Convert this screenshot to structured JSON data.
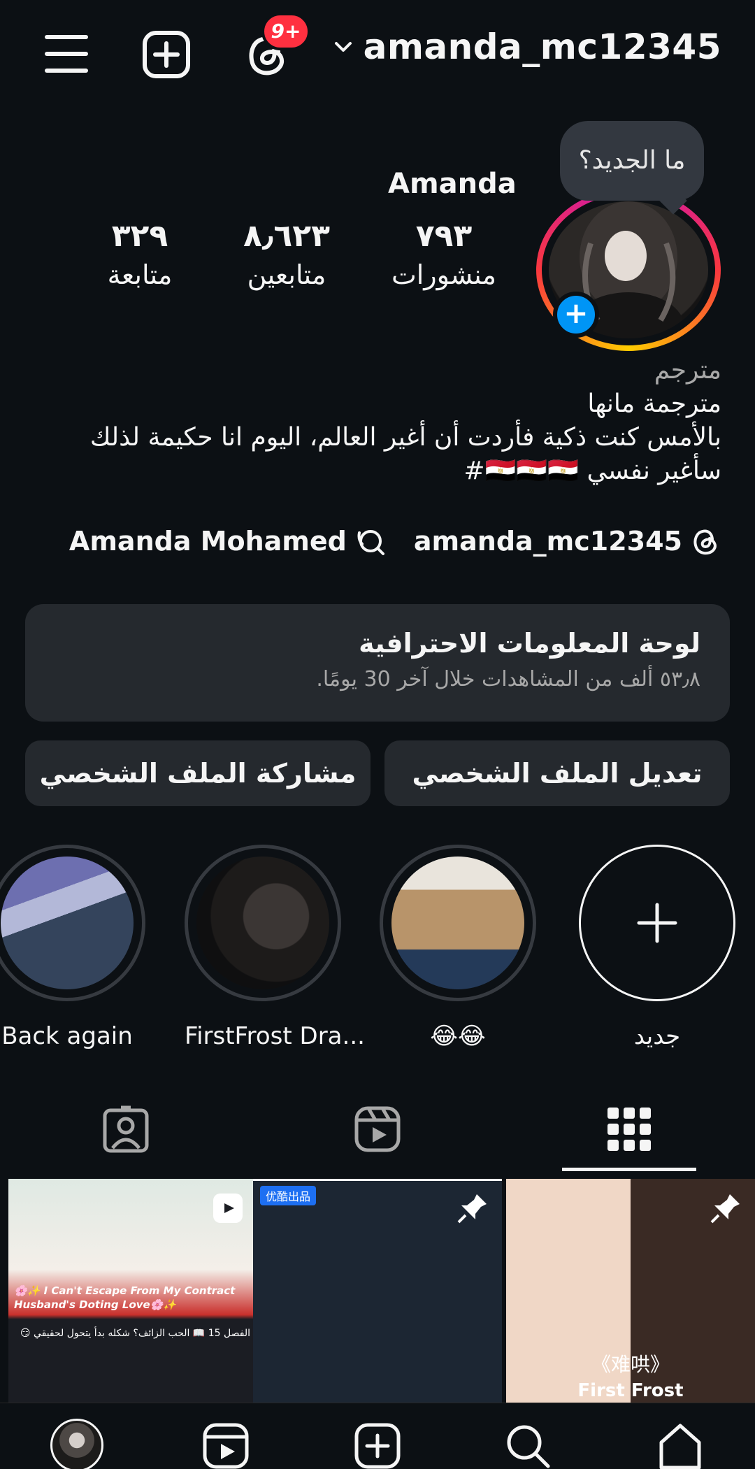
{
  "header": {
    "username": "amanda_mc12345",
    "notification_badge": "9+"
  },
  "tooltip": "ما الجديد؟",
  "profile": {
    "display_name": "Amanda",
    "stats": [
      {
        "num": "٧٩٣",
        "label": "منشورات"
      },
      {
        "num": "٨٫٦٢٣",
        "label": "متابعين"
      },
      {
        "num": "٣٢٩",
        "label": "متابعة"
      }
    ]
  },
  "bio": {
    "category": "مترجم",
    "line1": "مترجمة مانها",
    "line2": "بالأمس كنت ذكية فأردت أن أغير العالم، اليوم انا حكيمة لذلك",
    "line3": "سأغير نفسي 🇪🇬🇪🇬🇪🇬#"
  },
  "links": {
    "threads_handle": "amanda_mc12345",
    "linked_name": "Amanda Mohamed"
  },
  "dashboard": {
    "title": "لوحة المعلومات الاحترافية",
    "subtitle": "٥٣٫٨ ألف من المشاهدات خلال آخر 30 يومًا."
  },
  "buttons": {
    "edit": "تعديل الملف الشخصي",
    "share": "مشاركة الملف الشخصي"
  },
  "highlights": [
    {
      "label": "جديد"
    },
    {
      "label": "😂😂"
    },
    {
      "label": "FirstFrost Dra..."
    },
    {
      "label": "Back again"
    }
  ],
  "posts": {
    "post1_caption": "🌸✨ I Can't Escape From My Contract Husband's Doting Love🌸✨",
    "post1_arabic": "الفصل 15 📖 الحب الزائف؟ شكله بدأ يتحول لحقيقي 😏",
    "post2_tag": "优酷出品",
    "post3_title": "《难哄》",
    "post3_subtitle": "First Frost"
  },
  "colors": {
    "background": "#0c1014",
    "surface": "#25292e",
    "accent": "#0095f6",
    "badge": "#ff3040"
  }
}
